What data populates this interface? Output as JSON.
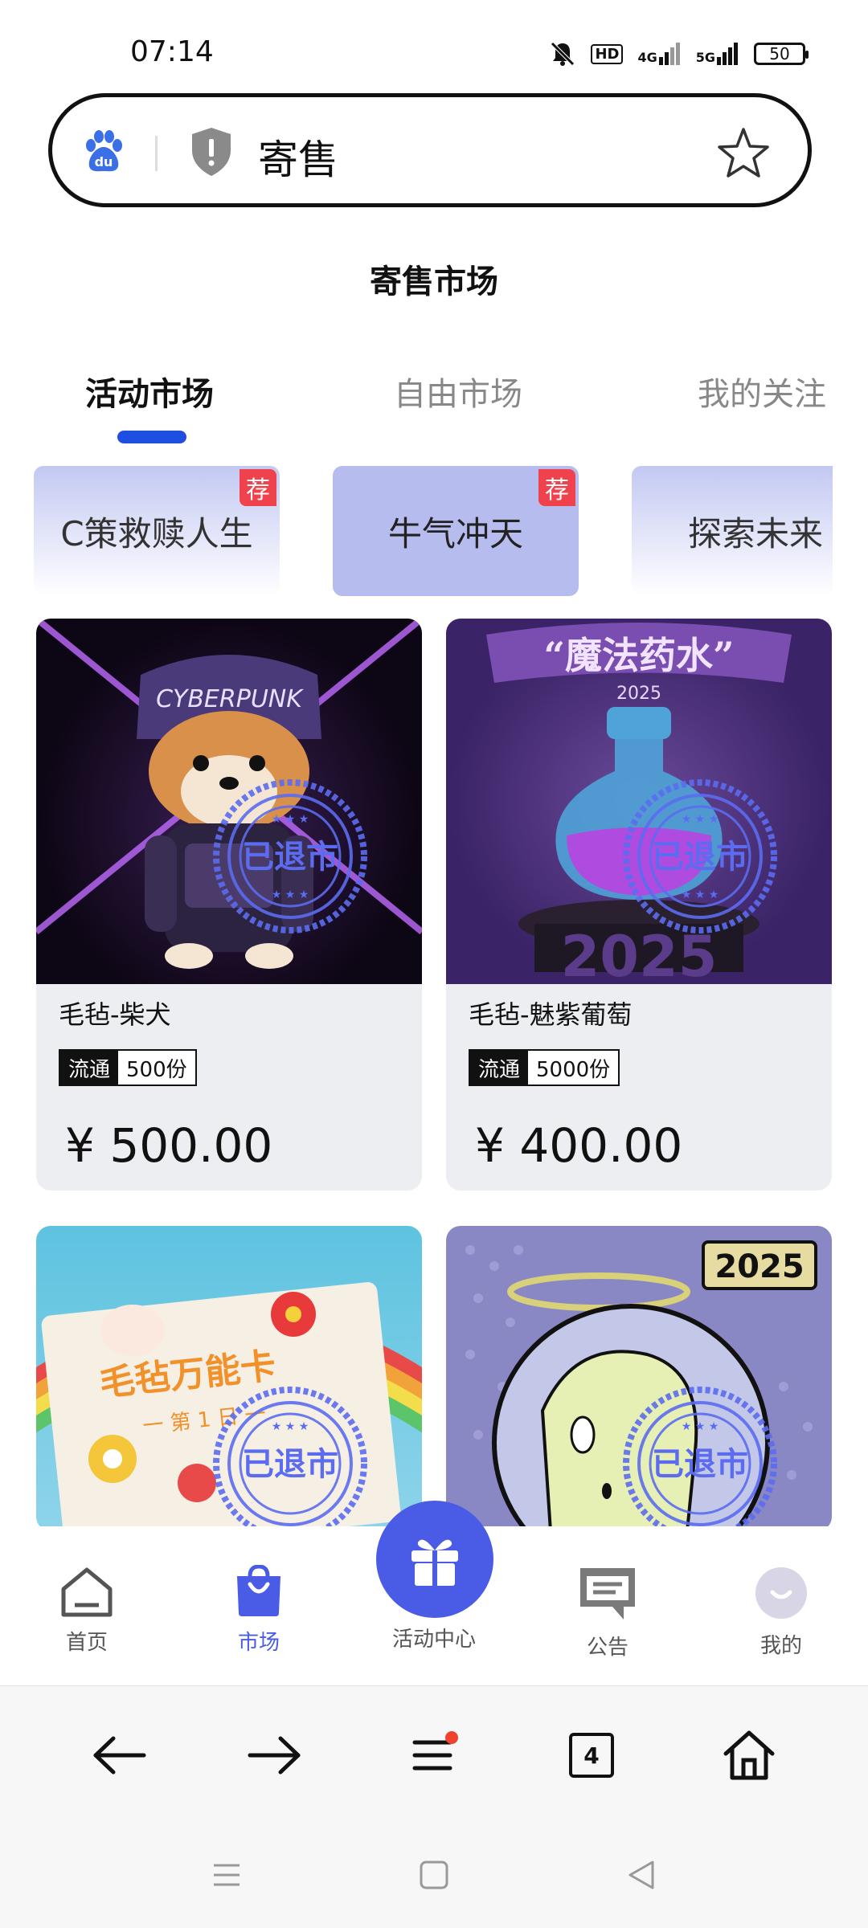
{
  "status_bar": {
    "time": "07:14",
    "signal_4g": "4G",
    "signal_5g": "5G",
    "hd_label": "HD",
    "battery": "50"
  },
  "address_bar": {
    "text": "寄售",
    "logo_text": "du"
  },
  "page": {
    "title": "寄售市场"
  },
  "tabs": [
    {
      "label": "活动市场",
      "active": true
    },
    {
      "label": "自由市场",
      "active": false
    },
    {
      "label": "我的关注",
      "active": false
    }
  ],
  "categories": [
    {
      "label": "C策救赎人生",
      "badge": "荐"
    },
    {
      "label": "牛气冲天",
      "badge": "荐"
    },
    {
      "label": "探索未来",
      "badge": ""
    }
  ],
  "products": [
    {
      "name": "毛毡-柴犬",
      "tag_type": "流通",
      "tag_amount": "500份",
      "price": "¥ 500.00",
      "stamp": "已退市",
      "image_text": "CYBERPUNK"
    },
    {
      "name": "毛毡-魅紫葡萄",
      "tag_type": "流通",
      "tag_amount": "5000份",
      "price": "¥ 400.00",
      "stamp": "已退市",
      "image_text": "“魔法药水”",
      "image_year": "2025",
      "image_year2": "2025"
    },
    {
      "name": "",
      "stamp": "已退市",
      "image_text": "毛毡万能卡",
      "image_sub": "一 第 1 日 一"
    },
    {
      "name": "",
      "stamp": "已退市",
      "image_year": "2025"
    }
  ],
  "bottom_nav": {
    "home": "首页",
    "market": "市场",
    "activity": "活动中心",
    "notice": "公告",
    "mine": "我的"
  },
  "browser_bar": {
    "tab_count": "4"
  },
  "colors": {
    "accent": "#4a5ce6",
    "tab_indicator": "#1f4fe0",
    "badge_red": "#f0424c"
  }
}
